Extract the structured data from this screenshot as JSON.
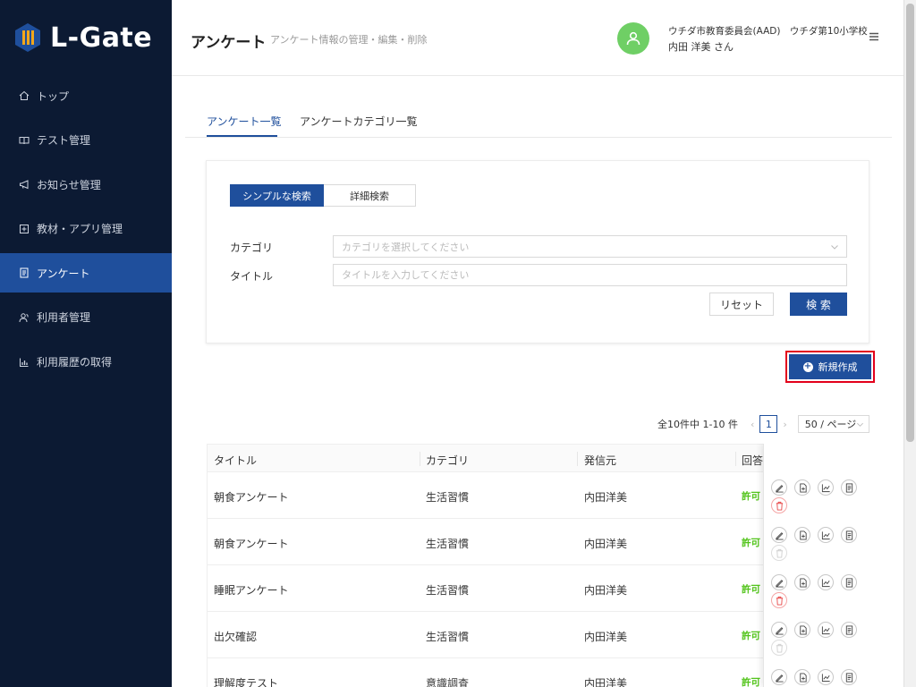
{
  "app": {
    "logo_text": "L-Gate"
  },
  "sidebar": {
    "items": [
      {
        "label": "トップ",
        "icon": "home-icon"
      },
      {
        "label": "テスト管理",
        "icon": "book-icon"
      },
      {
        "label": "お知らせ管理",
        "icon": "megaphone-icon"
      },
      {
        "label": "教材・アプリ管理",
        "icon": "plus-square-icon"
      },
      {
        "label": "アンケート",
        "icon": "form-icon",
        "active": true
      },
      {
        "label": "利用者管理",
        "icon": "users-icon"
      },
      {
        "label": "利用履歴の取得",
        "icon": "bar-chart-icon"
      }
    ]
  },
  "header": {
    "title": "アンケート",
    "subtitle": "アンケート情報の管理・編集・削除",
    "user_org": "ウチダ市教育委員会(AAD)　ウチダ第10小学校",
    "user_name": "内田 洋美 さん"
  },
  "tabs": [
    {
      "label": "アンケート一覧",
      "active": true
    },
    {
      "label": "アンケートカテゴリ一覧",
      "active": false
    }
  ],
  "search": {
    "mode_simple": "シンプルな検索",
    "mode_detail": "詳細検索",
    "category_label": "カテゴリ",
    "category_placeholder": "カテゴリを選択してください",
    "title_label": "タイトル",
    "title_placeholder": "タイトルを入力してください",
    "reset_label": "リセット",
    "search_label": "検 索"
  },
  "new_button": {
    "label": "新規作成"
  },
  "pagination": {
    "summary": "全10件中 1-10 件",
    "current_page": "1",
    "page_size": "50 / ページ"
  },
  "table": {
    "columns": [
      "タイトル",
      "カテゴリ",
      "発信元",
      "回答"
    ],
    "rows": [
      {
        "title": "朝食アンケート",
        "category": "生活習慣",
        "sender": "内田洋美",
        "status": "許可",
        "deletable": true
      },
      {
        "title": "朝食アンケート",
        "category": "生活習慣",
        "sender": "内田洋美",
        "status": "許可",
        "deletable": false
      },
      {
        "title": "睡眠アンケート",
        "category": "生活習慣",
        "sender": "内田洋美",
        "status": "許可",
        "deletable": true
      },
      {
        "title": "出欠確認",
        "category": "生活習慣",
        "sender": "内田洋美",
        "status": "許可",
        "deletable": false
      },
      {
        "title": "理解度テスト",
        "category": "意識調査",
        "sender": "内田洋美",
        "status": "許可",
        "deletable": true
      }
    ]
  },
  "colors": {
    "sidebar_bg": "#0c1a33",
    "primary": "#1f4f9c",
    "avatar": "#6fcf65",
    "success": "#52c41a",
    "highlight": "#e3001b"
  }
}
